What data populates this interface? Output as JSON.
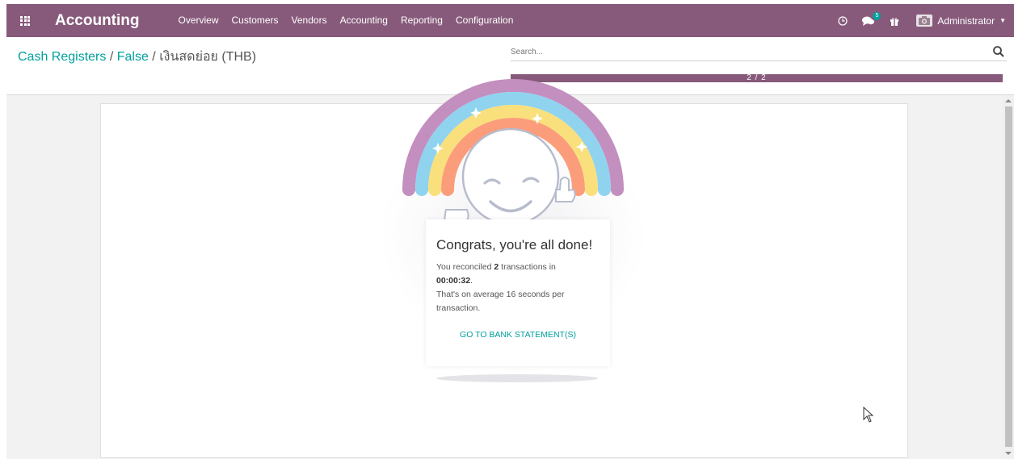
{
  "navbar": {
    "brand": "Accounting",
    "menu": [
      "Overview",
      "Customers",
      "Vendors",
      "Accounting",
      "Reporting",
      "Configuration"
    ],
    "chat_badge": "5",
    "user": "Administrator"
  },
  "control": {
    "breadcrumb": {
      "root": "Cash Registers",
      "middle": "False",
      "current": "เงินสดย่อย (THB)",
      "separator": " / "
    },
    "search_placeholder": "Search...",
    "progress_text": "2 / 2",
    "progress_fraction": 1.0
  },
  "done_card": {
    "title": "Congrats, you're all done!",
    "line1_prefix": "You reconciled ",
    "count": "2",
    "line1_suffix": " transactions in",
    "time": "00:00:32",
    "period": ".",
    "line2": "That's on average 16 seconds per transaction.",
    "button": "GO TO BANK STATEMENT(S)"
  },
  "colors": {
    "brand": "#875a7b",
    "accent": "#00a09d"
  },
  "icons": [
    "apps-grid-icon",
    "clock-icon",
    "chat-icon",
    "gift-icon",
    "avatar-icon",
    "caret-down-icon",
    "search-icon",
    "mouse-cursor-icon"
  ]
}
